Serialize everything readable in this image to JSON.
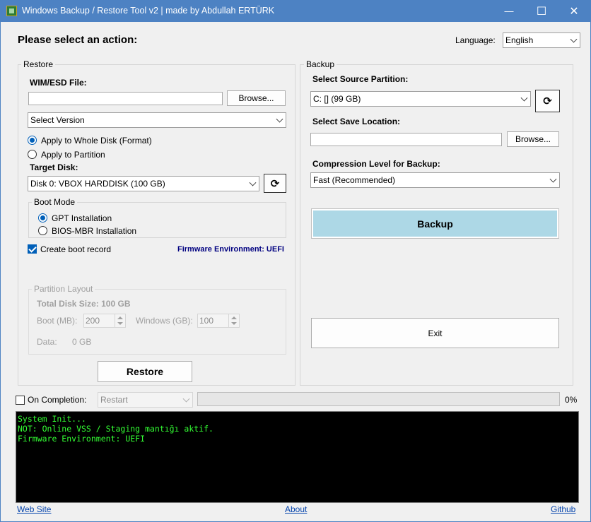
{
  "window": {
    "title": "Windows Backup / Restore Tool v2 | made by Abdullah ERTÜRK",
    "minimize": "—",
    "maximize": "☐",
    "close": "✕"
  },
  "heading": "Please select an action:",
  "language": {
    "label": "Language:",
    "value": "English"
  },
  "restore": {
    "group_title": "Restore",
    "wim_label": "WIM/ESD File:",
    "wim_value": "",
    "browse_label": "Browse...",
    "version_value": "Select Version",
    "apply_whole_disk": "Apply to Whole Disk (Format)",
    "apply_partition": "Apply to Partition",
    "target_disk_label": "Target Disk:",
    "target_disk_value": "Disk 0: VBOX HARDDISK (100 GB)",
    "boot_mode_title": "Boot Mode",
    "gpt_label": "GPT Installation",
    "mbr_label": "BIOS-MBR Installation",
    "create_boot_record": "Create boot record",
    "firmware_label": "Firmware Environment: UEFI",
    "partition_layout": {
      "title": "Partition Layout",
      "total_disk": "Total Disk Size: 100 GB",
      "boot_label": "Boot (MB):",
      "boot_value": "200",
      "windows_label": "Windows (GB):",
      "windows_value": "100",
      "data_label": "Data:",
      "data_value": "0 GB"
    },
    "restore_button": "Restore"
  },
  "backup": {
    "group_title": "Backup",
    "source_label": "Select Source Partition:",
    "source_value": "C: [] (99 GB)",
    "save_label": "Select Save Location:",
    "save_value": "",
    "browse_label": "Browse...",
    "compression_label": "Compression Level for Backup:",
    "compression_value": "Fast (Recommended)",
    "backup_button": "Backup",
    "exit_button": "Exit"
  },
  "completion": {
    "label": "On Completion:",
    "value": "Restart",
    "progress_percent": 0,
    "progress_text": "0%"
  },
  "console_lines": [
    "System Init...",
    "NOT: Online VSS / Staging mantığı aktif.",
    "Firmware Environment: UEFI"
  ],
  "footer": {
    "website": "Web Site",
    "about": "About",
    "github": "Github"
  },
  "icons": {
    "refresh": "⟳"
  },
  "colors": {
    "titlebar": "#4d82c3",
    "backup_button": "#add8e6",
    "firmware_text": "#000080",
    "console_text": "#33ff33",
    "accent": "#005fb8"
  }
}
